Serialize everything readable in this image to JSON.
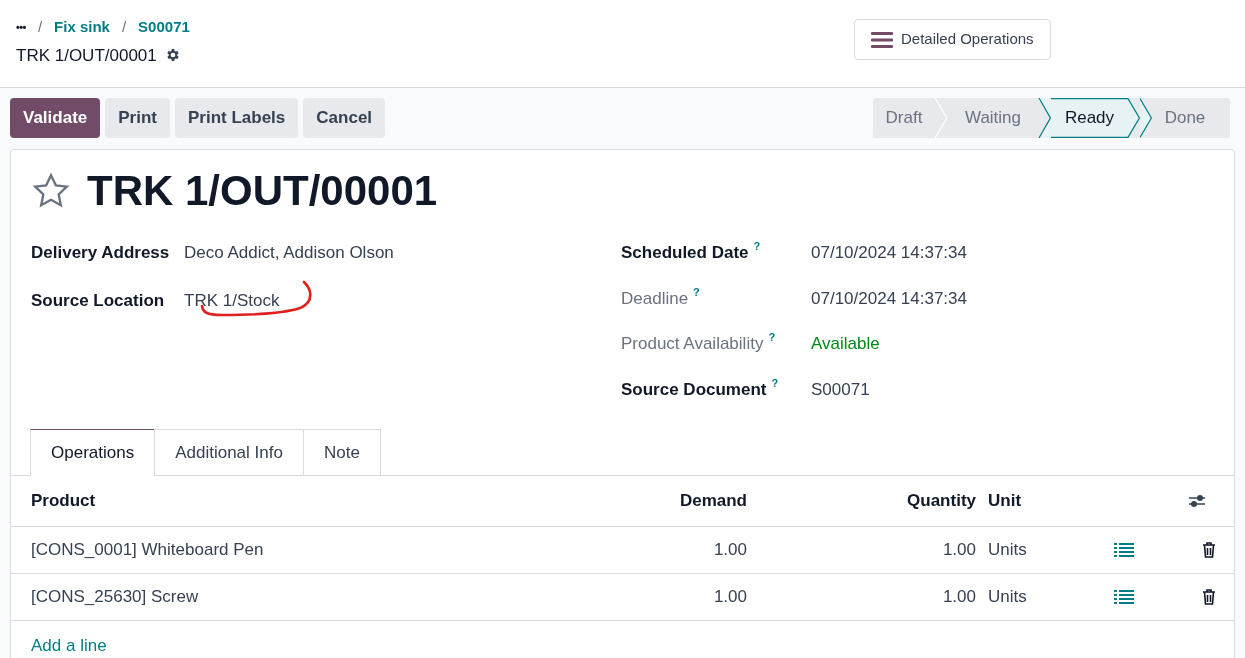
{
  "breadcrumbs": {
    "menu": "•••",
    "separator": "/",
    "items": [
      "Fix sink",
      "S00071"
    ],
    "current": "TRK 1/OUT/00001"
  },
  "detailed_operations": "Detailed Operations",
  "actions": [
    {
      "label": "Validate",
      "kind": "primary"
    },
    {
      "label": "Print",
      "kind": "secondary"
    },
    {
      "label": "Print Labels",
      "kind": "secondary"
    },
    {
      "label": "Cancel",
      "kind": "secondary"
    }
  ],
  "stages": [
    {
      "label": "Draft",
      "selected": false
    },
    {
      "label": "Waiting",
      "selected": false
    },
    {
      "label": "Ready",
      "selected": true
    },
    {
      "label": "Done",
      "selected": false
    }
  ],
  "record": {
    "title": "TRK 1/OUT/00001",
    "starred": false,
    "left_fields": [
      {
        "label": "Delivery Address",
        "value": "Deco Addict, Addison Olson",
        "circled": false
      },
      {
        "label": "Source Location",
        "value": "TRK 1/Stock",
        "circled": true
      }
    ],
    "right_fields": [
      {
        "label": "Scheduled Date",
        "help": "?",
        "value": "07/10/2024 14:37:34",
        "muted": false,
        "highlighted": false
      },
      {
        "label": "Deadline",
        "help": "?",
        "value": "07/10/2024 14:37:34",
        "muted": true,
        "highlighted": false
      },
      {
        "label": "Product Availability",
        "help": "?",
        "value": "Available",
        "muted": true,
        "highlighted": true
      },
      {
        "label": "Source Document",
        "help": "?",
        "value": "S00071",
        "muted": false,
        "highlighted": false
      }
    ]
  },
  "tabs": [
    {
      "label": "Operations",
      "selected": true
    },
    {
      "label": "Additional Info",
      "selected": false
    },
    {
      "label": "Note",
      "selected": false
    }
  ],
  "table": {
    "columns": [
      "Product",
      "Demand",
      "Quantity",
      "Unit"
    ],
    "rows": [
      {
        "product": "[CONS_0001] Whiteboard Pen",
        "demand": "1.00",
        "quantity": "1.00",
        "unit": "Units"
      },
      {
        "product": "[CONS_25630] Screw",
        "demand": "1.00",
        "quantity": "1.00",
        "unit": "Units"
      }
    ],
    "add_line": "Add a line"
  }
}
